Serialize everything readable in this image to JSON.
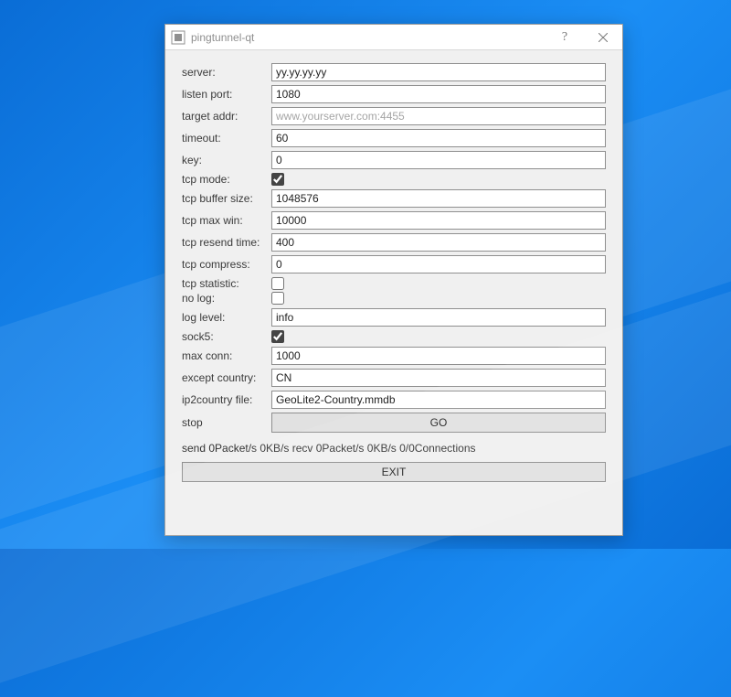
{
  "window": {
    "title": "pingtunnel-qt"
  },
  "fields": {
    "server": {
      "label": "server:",
      "value": "yy.yy.yy.yy",
      "placeholder": ""
    },
    "listen_port": {
      "label": "listen port:",
      "value": "1080",
      "placeholder": ""
    },
    "target_addr": {
      "label": "target addr:",
      "value": "",
      "placeholder": "www.yourserver.com:4455"
    },
    "timeout": {
      "label": "timeout:",
      "value": "60",
      "placeholder": ""
    },
    "key": {
      "label": "key:",
      "value": "0",
      "placeholder": ""
    },
    "tcp_mode": {
      "label": "tcp mode:",
      "checked": true
    },
    "tcp_buffer_size": {
      "label": "tcp buffer size:",
      "value": "1048576",
      "placeholder": ""
    },
    "tcp_max_win": {
      "label": "tcp max win:",
      "value": "10000",
      "placeholder": ""
    },
    "tcp_resend_time": {
      "label": "tcp resend time:",
      "value": "400",
      "placeholder": ""
    },
    "tcp_compress": {
      "label": "tcp compress:",
      "value": "0",
      "placeholder": ""
    },
    "tcp_statistic": {
      "label": "tcp statistic:",
      "checked": false
    },
    "no_log": {
      "label": "no log:",
      "checked": false
    },
    "log_level": {
      "label": "log level:",
      "value": "info",
      "placeholder": ""
    },
    "sock5": {
      "label": "sock5:",
      "checked": true
    },
    "max_conn": {
      "label": "max conn:",
      "value": "1000",
      "placeholder": ""
    },
    "except_country": {
      "label": "except country:",
      "value": "CN",
      "placeholder": ""
    },
    "ip2country_file": {
      "label": "ip2country file:",
      "value": "GeoLite2-Country.mmdb",
      "placeholder": ""
    }
  },
  "actions": {
    "stop_label": "stop",
    "go_label": "GO",
    "exit_label": "EXIT"
  },
  "status": "send 0Packet/s 0KB/s recv 0Packet/s 0KB/s 0/0Connections"
}
